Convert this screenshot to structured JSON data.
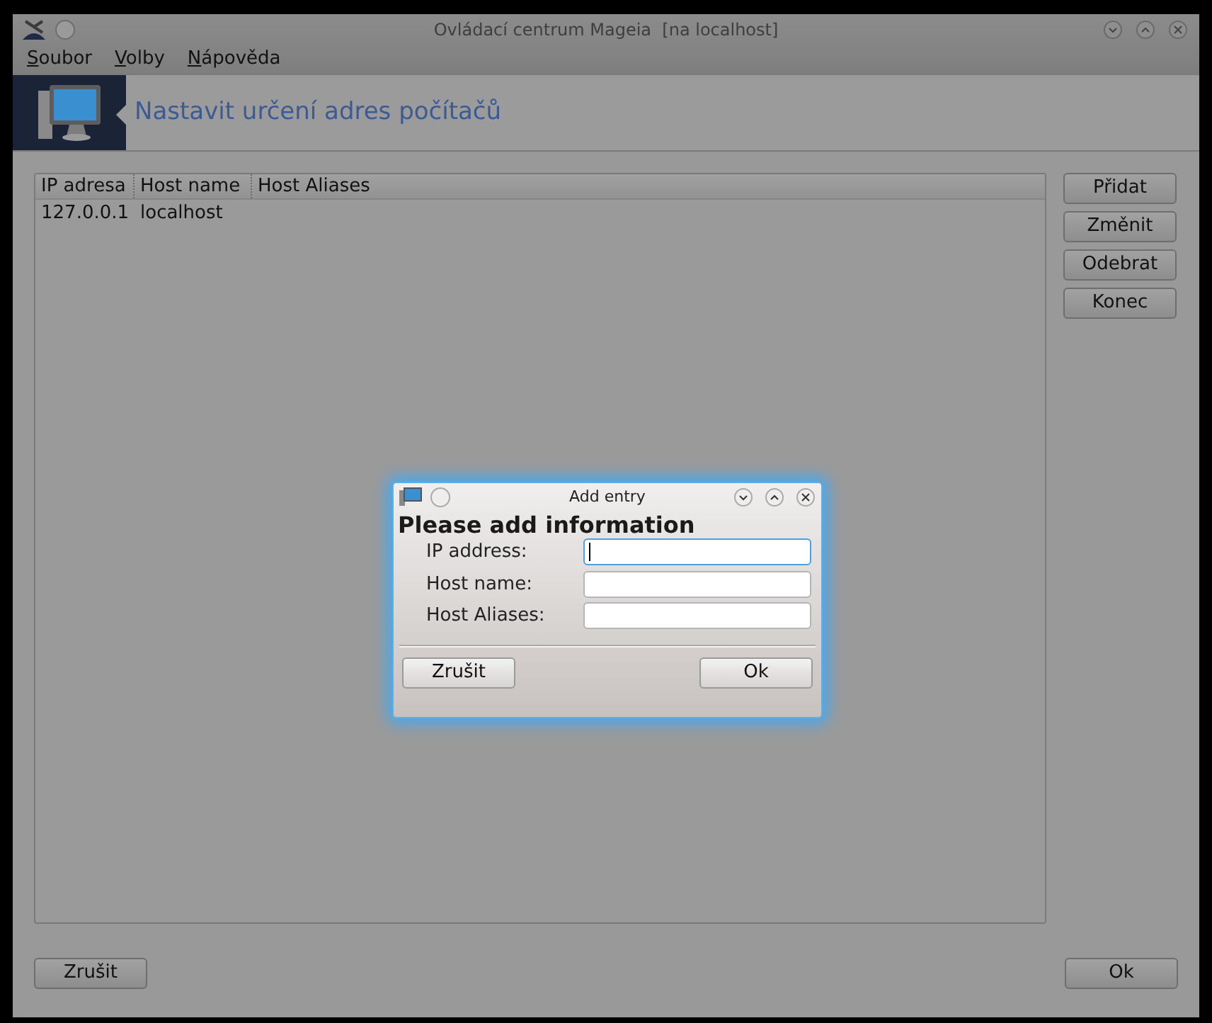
{
  "window": {
    "title": "Ovládací centrum Mageia  [na localhost]"
  },
  "menu": [
    {
      "label": "Soubor"
    },
    {
      "label": "Volby"
    },
    {
      "label": "Nápověda"
    }
  ],
  "banner": {
    "title": "Nastavit určení adres počítačů"
  },
  "table": {
    "columns": [
      "IP adresa",
      "Host name",
      "Host Aliases"
    ],
    "rows": [
      [
        "127.0.0.1",
        "localhost",
        ""
      ]
    ]
  },
  "side_buttons": [
    "Přidat",
    "Změnit",
    "Odebrat",
    "Konec"
  ],
  "bottom_buttons": {
    "cancel": "Zrušit",
    "ok": "Ok"
  },
  "dialog": {
    "title": "Add entry",
    "heading": "Please add information",
    "fields": [
      {
        "label": "IP address:",
        "focused": true
      },
      {
        "label": "Host name:",
        "focused": false
      },
      {
        "label": "Host Aliases:",
        "focused": false
      }
    ],
    "buttons": {
      "cancel": "Zrušit",
      "ok": "Ok"
    }
  }
}
